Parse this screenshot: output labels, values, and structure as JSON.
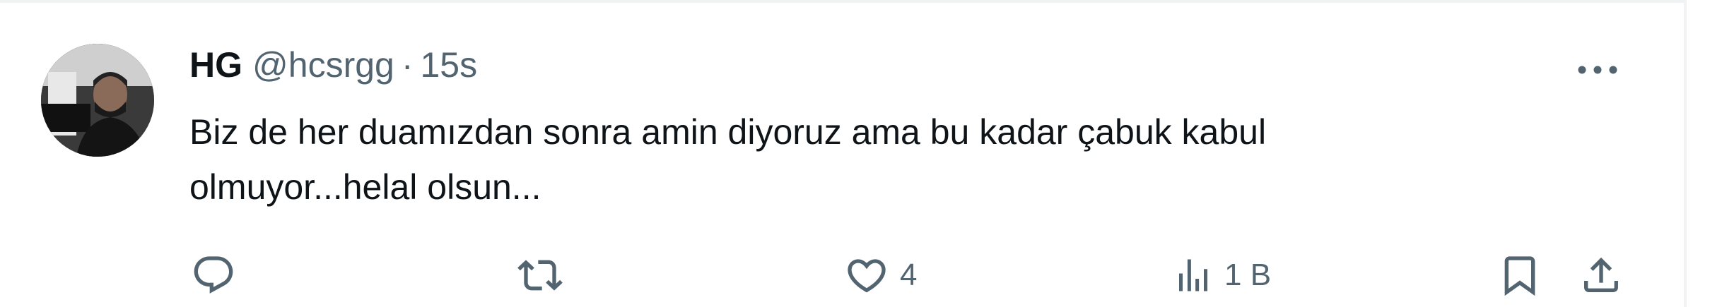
{
  "tweet": {
    "author": {
      "display_name": "HG",
      "handle": "@hcsrgg",
      "avatar_icon": "user-avatar-photo"
    },
    "separator": "·",
    "timestamp": "15s",
    "text_lines": [
      "Biz de her duamızdan sonra amin diyoruz ama bu kadar çabuk kabul",
      "olmuyor...helal olsun..."
    ],
    "more_icon": "more-horizontal-icon"
  },
  "actions": {
    "reply": {
      "icon": "reply-icon",
      "count": ""
    },
    "retweet": {
      "icon": "retweet-icon",
      "count": ""
    },
    "like": {
      "icon": "heart-icon",
      "count": "4"
    },
    "views": {
      "icon": "views-chart-icon",
      "count": "1 B"
    },
    "bookmark": {
      "icon": "bookmark-icon"
    },
    "share": {
      "icon": "share-icon"
    }
  },
  "colors": {
    "text_primary": "#0f1419",
    "text_secondary": "#536471",
    "divider": "#eff3f4"
  }
}
